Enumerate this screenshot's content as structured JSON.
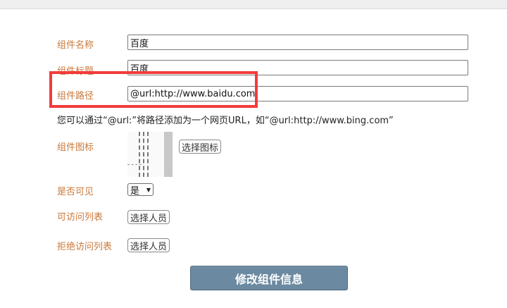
{
  "form": {
    "name_label": "组件名称",
    "name_value": "百度",
    "title_label": "组件标题",
    "title_value": "百度",
    "path_label": "组件路径",
    "path_value": "@url:http://www.baidu.com",
    "path_hint": "您可以通过“@url:”将路径添加为一个网页URL，如“@url:http://www.bing.com”",
    "icon_label": "组件图标",
    "choose_icon_label": "选择图标",
    "visible_label": "是否可见",
    "visible_value": "是",
    "allow_list_label": "可访问列表",
    "allow_choose_label": "选择人员",
    "deny_list_label": "拒绝访问列表",
    "deny_choose_label": "选择人员",
    "submit_label": "修改组件信息"
  },
  "colors": {
    "label": "#c9783a",
    "highlight": "#f23b3b",
    "submit_bg": "#6b8aa1"
  }
}
